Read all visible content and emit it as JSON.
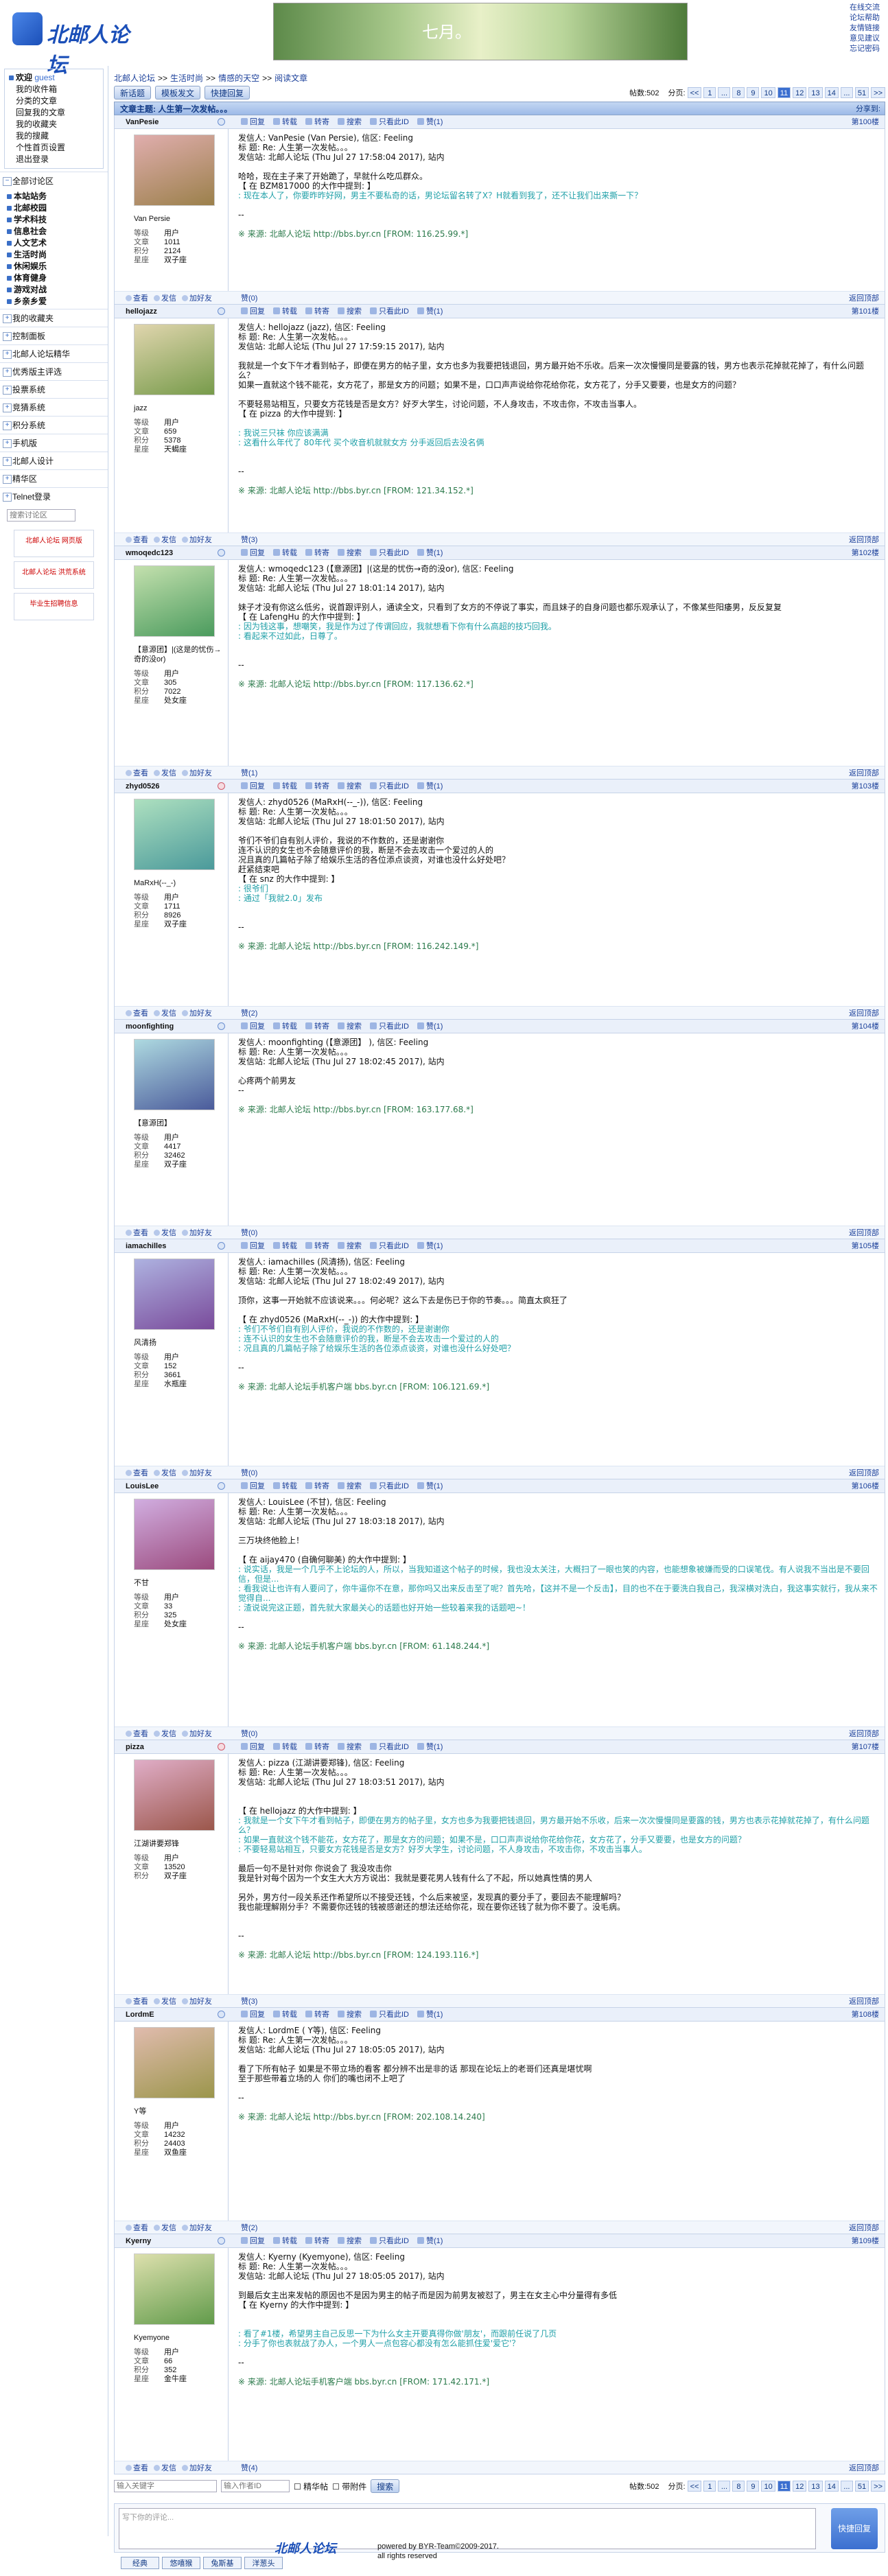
{
  "site": {
    "logo_text": "北邮人论坛",
    "banner_text": "七月。",
    "top_links": [
      "在线交流",
      "论坛帮助",
      "友情链接",
      "意见建议",
      "忘记密码"
    ]
  },
  "sidebar": {
    "welcome": "欢迎",
    "user": "guest",
    "user_links": [
      "我的收件箱",
      "分类的文章",
      "回复我的文章",
      "我的收藏夹",
      "我的搜藏",
      "个性首页设置",
      "退出登录"
    ],
    "all_sections": "全部讨论区",
    "sections": [
      "本站站务",
      "北邮校园",
      "学术科技",
      "信息社会",
      "人文艺术",
      "生活时尚",
      "休闲娱乐",
      "体育健身",
      "游戏对战",
      "乡亲乡爱"
    ],
    "more": [
      "我的收藏夹",
      "控制面板",
      "北邮人论坛精华",
      "优秀版主评选",
      "投票系统",
      "竞猜系统",
      "积分系统",
      "手机版",
      "北邮人设计",
      "精华区",
      "Telnet登录"
    ],
    "search_placeholder": "搜索讨论区",
    "ads": [
      "北邮人论坛 网页版",
      "北邮人论坛 洪荒系统",
      "毕业生招聘信息"
    ]
  },
  "crumbs": [
    "北邮人论坛",
    ">>",
    "生活时尚",
    ">>",
    "情感的天空",
    ">>",
    "阅读文章"
  ],
  "toolbar": {
    "new_topic": "新话题",
    "mode": "模板发文",
    "quick": "快捷回复"
  },
  "pager": {
    "total_label": "帖数:502",
    "pages_label": "分页:",
    "pages": [
      "<<",
      "1",
      "...",
      "8",
      "9",
      "10",
      "11",
      "12",
      "13",
      "14",
      "...",
      "51",
      ">>"
    ],
    "current": "11"
  },
  "thread_title": "文章主题: 人生第一次发帖。。。",
  "share_label": "分享到:",
  "actions": [
    "回复",
    "转载",
    "转寄",
    "搜索",
    "只看此ID",
    "赞"
  ],
  "foot_actions": [
    "查看",
    "发信",
    "加好友"
  ],
  "back_top": "返回顶部",
  "stat_labels": [
    "等级",
    "文章",
    "积分",
    "星座"
  ],
  "posts": [
    {
      "id": "VanPesie",
      "nick": "Van Persie",
      "stats": [
        "用户",
        "1011",
        "2124",
        "双子座"
      ],
      "floor": "第100楼",
      "likes": "赞(1)",
      "fav": "赞(0)",
      "gender": "m",
      "lines": [
        [
          "",
          "发信人: VanPesie (Van Persie), 信区: Feeling"
        ],
        [
          "",
          "标  题: Re: 人生第一次发帖。。。"
        ],
        [
          "",
          "发信站: 北邮人论坛 (Thu Jul 27 17:58:04 2017), 站内"
        ],
        [
          "",
          ""
        ],
        [
          "",
          "哈哈，现在主子来了开始跪了，早就什么吃瓜群众。"
        ],
        [
          "",
          "【 在 BZM817000 的大作中提到: 】"
        ],
        [
          "q",
          ": 现在本人了，你要昨昨好网，男主不要私奇的话，男论坛留名转了X？H就看到我了，还不让我们出来撕一下？"
        ],
        [
          "",
          ""
        ],
        [
          "",
          "--"
        ],
        [
          "",
          ""
        ],
        [
          "s",
          "※ 来源: 北邮人论坛 http://bbs.byr.cn [FROM: 116.25.99.*]"
        ]
      ]
    },
    {
      "id": "hellojazz",
      "nick": "jazz",
      "stats": [
        "用户",
        "659",
        "5378",
        "天蝎座"
      ],
      "floor": "第101楼",
      "likes": "赞(1)",
      "fav": "赞(3)",
      "gender": "m",
      "lines": [
        [
          "",
          "发信人: hellojazz (jazz), 信区: Feeling"
        ],
        [
          "",
          "标  题: Re: 人生第一次发帖。。。"
        ],
        [
          "",
          "发信站: 北邮人论坛 (Thu Jul 27 17:59:15 2017), 站内"
        ],
        [
          "",
          ""
        ],
        [
          "",
          "我就是一个女下午才看到帖子，即便在男方的帖子里，女方也多为我要把钱退回，男方最开始不乐收。后来一次次慢慢同是要露的钱，男方也表示花掉就花掉了，有什么问题么？"
        ],
        [
          "",
          "如果一直就这个钱不能花，女方花了，那是女方的问题；如果不是，口口声声说给你花给你花，女方花了，分手又要要，也是女方的问题？"
        ],
        [
          "",
          ""
        ],
        [
          "",
          "不要轻易站相互，只要女方花钱是否是女方？好歹大学生，讨论问题，不人身攻击，不攻击你，不攻击当事人。"
        ],
        [
          "",
          "【 在 pizza 的大作中提到: 】"
        ],
        [
          "",
          ""
        ],
        [
          "q",
          ": 我说三只袜 你应该满满"
        ],
        [
          "q",
          ": 这看什么年代了  80年代  买个收音机就就女方    分手返回后去没名俩"
        ],
        [
          "",
          ""
        ],
        [
          "",
          ""
        ],
        [
          "",
          "--"
        ],
        [
          "",
          ""
        ],
        [
          "s",
          "※ 来源: 北邮人论坛 http://bbs.byr.cn [FROM: 121.34.152.*]"
        ]
      ]
    },
    {
      "id": "wmoqedc123",
      "nick": "【意源团】|(这是的忧伤→奇的没or)",
      "stats": [
        "用户",
        "305",
        "7022",
        "处女座"
      ],
      "floor": "第102楼",
      "likes": "赞(1)",
      "fav": "赞(1)",
      "gender": "m",
      "lines": [
        [
          "",
          "发信人: wmoqedc123 (【意源团】|(这是的忧伤→奇的没or), 信区: Feeling"
        ],
        [
          "",
          "标  题: Re: 人生第一次发帖。。。"
        ],
        [
          "",
          "发信站: 北邮人论坛 (Thu Jul 27 18:01:14 2017), 站内"
        ],
        [
          "",
          ""
        ],
        [
          "",
          "妹子才没有你这么低劣，说首跟评别人，通读全文，只看到了女方的不停说了事实，而且妹子的自身问题也都乐观承认了，不像某些阳痿男，反反复复"
        ],
        [
          "",
          "【 在 LafengHu 的大作中提到: 】"
        ],
        [
          "q",
          ": 因为钱这事，想嘲笑，我是作为过了传谓回应，我就想看下你有什么高超的技巧回我。"
        ],
        [
          "q",
          ": 看起来不过如此，日尊了。"
        ],
        [
          "",
          ""
        ],
        [
          "",
          ""
        ],
        [
          "",
          "--"
        ],
        [
          "",
          ""
        ],
        [
          "s",
          "※ 来源: 北邮人论坛 http://bbs.byr.cn [FROM: 117.136.62.*]"
        ]
      ]
    },
    {
      "id": "zhyd0526",
      "nick": "MaRxH(--_-)",
      "stats": [
        "用户",
        "1711",
        "8926",
        "双子座"
      ],
      "floor": "第103楼",
      "likes": "赞(1)",
      "fav": "赞(2)",
      "gender": "f",
      "lines": [
        [
          "",
          "发信人: zhyd0526 (MaRxH(--_-)), 信区: Feeling"
        ],
        [
          "",
          "标  题: Re: 人生第一次发帖。。。"
        ],
        [
          "",
          "发信站: 北邮人论坛 (Thu Jul 27 18:01:50 2017), 站内"
        ],
        [
          "",
          ""
        ],
        [
          "",
          "爷们不爷们自有别人评价，我说的不作数的，还是谢谢你"
        ],
        [
          "",
          "连不认识的女生也不会随意评价的我，断是不会去攻击一个爱过的人的"
        ],
        [
          "",
          "况且真的几篇帖子除了给娱乐生活的各位添点谈资，对谁也没什么好处吧？"
        ],
        [
          "",
          "赶紧结束吧"
        ],
        [
          "",
          "【 在 snz 的大作中提到: 】"
        ],
        [
          "q",
          ": 很爷们"
        ],
        [
          "q",
          ": 通过「我就2.0」发布"
        ],
        [
          "",
          ""
        ],
        [
          "",
          ""
        ],
        [
          "",
          "--"
        ],
        [
          "",
          ""
        ],
        [
          "s",
          "※ 来源: 北邮人论坛 http://bbs.byr.cn [FROM: 116.242.149.*]"
        ]
      ]
    },
    {
      "id": "moonfighting",
      "nick": "【意源团】",
      "stats": [
        "用户",
        "4417",
        "32462",
        "双子座"
      ],
      "floor": "第104楼",
      "likes": "赞(1)",
      "fav": "赞(0)",
      "gender": "m",
      "lines": [
        [
          "",
          "发信人: moonfighting (【意源团】 ), 信区: Feeling"
        ],
        [
          "",
          "标  题: Re: 人生第一次发帖。。。"
        ],
        [
          "",
          "发信站: 北邮人论坛 (Thu Jul 27 18:02:45 2017), 站内"
        ],
        [
          "",
          ""
        ],
        [
          "",
          "心疼两个前男友"
        ],
        [
          "",
          "--"
        ],
        [
          "",
          ""
        ],
        [
          "s",
          "※ 来源: 北邮人论坛 http://bbs.byr.cn [FROM: 163.177.68.*]"
        ]
      ]
    },
    {
      "id": "iamachilles",
      "nick": "风清扬",
      "stats": [
        "用户",
        "152",
        "3661",
        "水瓶座"
      ],
      "floor": "第105楼",
      "likes": "赞(1)",
      "fav": "赞(0)",
      "gender": "m",
      "lines": [
        [
          "",
          "发信人: iamachilles (风清扬), 信区: Feeling"
        ],
        [
          "",
          "标  题: Re: 人生第一次发帖。。。"
        ],
        [
          "",
          "发信站: 北邮人论坛 (Thu Jul 27 18:02:49 2017), 站内"
        ],
        [
          "",
          ""
        ],
        [
          "",
          "顶你，这事一开始就不应该说来。。。何必呢？这么下去是伤已于你的节奏。。。简直太疯狂了"
        ],
        [
          "",
          ""
        ],
        [
          "",
          "【 在 zhyd0526 (MaRxH(--_-)) 的大作中提到: 】"
        ],
        [
          "q",
          ": 爷们不爷们自有别人评价，我说的不作数的，还是谢谢你"
        ],
        [
          "q",
          ": 连不认识的女生也不会随意评价的我，断是不会去攻击一个爱过的人的"
        ],
        [
          "q",
          ": 况且真的几篇帖子除了给娱乐生活的各位添点谈资，对谁也没什么好处吧？"
        ],
        [
          "",
          ""
        ],
        [
          "",
          "--"
        ],
        [
          "",
          ""
        ],
        [
          "s",
          "※ 来源: 北邮人论坛手机客户端 bbs.byr.cn [FROM: 106.121.69.*]"
        ]
      ]
    },
    {
      "id": "LouisLee",
      "nick": "不甘",
      "stats": [
        "用户",
        "33",
        "325",
        "处女座"
      ],
      "floor": "第106楼",
      "likes": "赞(1)",
      "fav": "赞(0)",
      "gender": "m",
      "lines": [
        [
          "",
          "发信人: LouisLee (不甘), 信区: Feeling"
        ],
        [
          "",
          "标  题: Re: 人生第一次发帖。。。"
        ],
        [
          "",
          "发信站: 北邮人论坛 (Thu Jul 27 18:03:18 2017), 站内"
        ],
        [
          "",
          ""
        ],
        [
          "",
          "三万块终他脸上！"
        ],
        [
          "",
          ""
        ],
        [
          "",
          "【 在 aijay470 (自确何聊美) 的大作中提到: 】"
        ],
        [
          "q",
          ": 说实话，我是一个几乎不上论坛的人，所以，当我知道这个帖子的时候，我也没太关注，大概扫了一眼也笑的内容，也能想象被嫌而受的口误笔伐。有人说我不当出是不要回信，但是..."
        ],
        [
          "q",
          ": 看我说让也许有人要问了，你牛逼你不在意，那你吗又出来反击至了呢？首先哈，【这并不是一个反击】，目的也不在于要洗白我自己，我深横对洗白，我这事实就行，我从来不觉得自..."
        ],
        [
          "q",
          ": 渣说说完这正题，首先就大家最关心的话题也好开始一些较着来我的话题吧~！"
        ],
        [
          "",
          ""
        ],
        [
          "",
          "--"
        ],
        [
          "",
          ""
        ],
        [
          "s",
          "※ 来源: 北邮人论坛手机客户端 bbs.byr.cn [FROM: 61.148.244.*]"
        ]
      ]
    },
    {
      "id": "pizza",
      "nick": "江湖讲要郑锋",
      "stats": [
        "用户",
        "13520",
        "双子座"
      ],
      "floor": "第107楼",
      "likes": "赞(1)",
      "fav": "赞(3)",
      "gender": "f",
      "lines": [
        [
          "",
          "发信人: pizza (江湖讲要郑锋), 信区: Feeling"
        ],
        [
          "",
          "标  题: Re: 人生第一次发帖。。。"
        ],
        [
          "",
          "发信站: 北邮人论坛 (Thu Jul 27 18:03:51 2017), 站内"
        ],
        [
          "",
          ""
        ],
        [
          "",
          ""
        ],
        [
          "",
          "【 在 hellojazz 的大作中提到: 】"
        ],
        [
          "q",
          ": 我就是一个女下午才看到帖子，即便在男方的帖子里，女方也多为我要把钱退回，男方最开始不乐收，后来一次次慢慢同是要露的钱，男方也表示花掉就花掉了，有什么问题么？"
        ],
        [
          "q",
          ": 如果一直就这个钱不能花，女方花了，那是女方的问题；如果不是，口口声声说给你花给你花，女方花了，分手又要要，也是女方的问题？"
        ],
        [
          "q",
          ": 不要轻易站相互，只要女方花钱是否是女方？好歹大学生，讨论问题，不人身攻击，不攻击你，不攻击当事人。"
        ],
        [
          "",
          ""
        ],
        [
          "",
          "最后一句不是针对你  你说会了  我没攻击你"
        ],
        [
          "",
          "我是针对每个因为一个女生大大方方说出：我就是要花男人钱有什么了不起，所以她真性情的男人"
        ],
        [
          "",
          ""
        ],
        [
          "",
          "另外，男方付一段关系还作希望所以不接受还钱，个么后来被坚，发现真的要分手了，要回去不能理解吗？"
        ],
        [
          "",
          "我也能理解刚分手？不需要你还钱的钱被感谢还的想法还给你花，现在要你还钱了就为你不要了。没毛病。"
        ],
        [
          "",
          ""
        ],
        [
          "",
          ""
        ],
        [
          "",
          "--"
        ],
        [
          "",
          ""
        ],
        [
          "s",
          "※ 来源: 北邮人论坛 http://bbs.byr.cn [FROM: 124.193.116.*]"
        ]
      ]
    },
    {
      "id": "LordmE",
      "nick": "Y等",
      "stats": [
        "用户",
        "14232",
        "24403",
        "双鱼座"
      ],
      "floor": "第108楼",
      "likes": "赞(1)",
      "fav": "赞(2)",
      "gender": "m",
      "lines": [
        [
          "",
          "发信人: LordmE ( Y等), 信区: Feeling"
        ],
        [
          "",
          "标  题: Re: 人生第一次发帖。。。"
        ],
        [
          "",
          "发信站: 北邮人论坛 (Thu Jul 27 18:05:05 2017), 站内"
        ],
        [
          "",
          ""
        ],
        [
          "",
          "看了下所有帖子 如果是不带立场的看客 都分辨不出是非的话 那现在论坛上的老哥们还真是堪忧啊"
        ],
        [
          "",
          "至于那些带着立场的人 你们的嘴也闭不上吧了"
        ],
        [
          "",
          ""
        ],
        [
          "",
          "--"
        ],
        [
          "",
          ""
        ],
        [
          "s",
          "※ 来源: 北邮人论坛 http://bbs.byr.cn [FROM: 202.108.14.240]"
        ]
      ]
    },
    {
      "id": "Kyerny",
      "nick": "Kyemyone",
      "stats": [
        "用户",
        "66",
        "352",
        "金牛座"
      ],
      "floor": "第109楼",
      "likes": "赞(1)",
      "fav": "赞(4)",
      "gender": "m",
      "lines": [
        [
          "",
          "发信人: Kyerny (Kyemyone), 信区: Feeling"
        ],
        [
          "",
          "标  题: Re: 人生第一次发帖。。。"
        ],
        [
          "",
          "发信站: 北邮人论坛 (Thu Jul 27 18:05:05 2017), 站内"
        ],
        [
          "",
          ""
        ],
        [
          "",
          "到最后女主出来发帖的原因也不是因为男主的帖子而是因为前男友被怼了，男主在女主心中分量得有多低"
        ],
        [
          "",
          "【 在 Kyerny 的大作中提到: 】"
        ],
        [
          "",
          ""
        ],
        [
          "",
          ""
        ],
        [
          "q",
          ": 看了#1楼，希望男主自己反思一下为什么女主开要真得你做'朋友'，而跟前任说了几页"
        ],
        [
          "q",
          ": 分手了你也表就战了办人，一个男人一点包容心都没有怎么能抓住爱'爱它'？"
        ],
        [
          "",
          ""
        ],
        [
          "",
          "--"
        ],
        [
          "",
          ""
        ],
        [
          "s",
          "※ 来源: 北邮人论坛手机客户端 bbs.byr.cn [FROM: 171.42.171.*]"
        ]
      ]
    }
  ],
  "bottom": {
    "kw_placeholder": "输入关键字",
    "author_placeholder": "输入作者ID",
    "opt1": "精华帖",
    "opt2": "带附件",
    "search": "搜索"
  },
  "reply": {
    "placeholder": "写下你的评论...",
    "submit": "快捷回复"
  },
  "emotabs": [
    "经典",
    "悠嘻猴",
    "兔斯基",
    "洋葱头"
  ],
  "footer": {
    "logo": "北邮人论坛",
    "line1": "powered by BYR-Team©2009-2017.",
    "line2": "all rights reserved"
  },
  "colors": {
    "accent": "#3b6fd0",
    "header_bg": "#c4d7f2",
    "quote": "#20a0a8"
  }
}
